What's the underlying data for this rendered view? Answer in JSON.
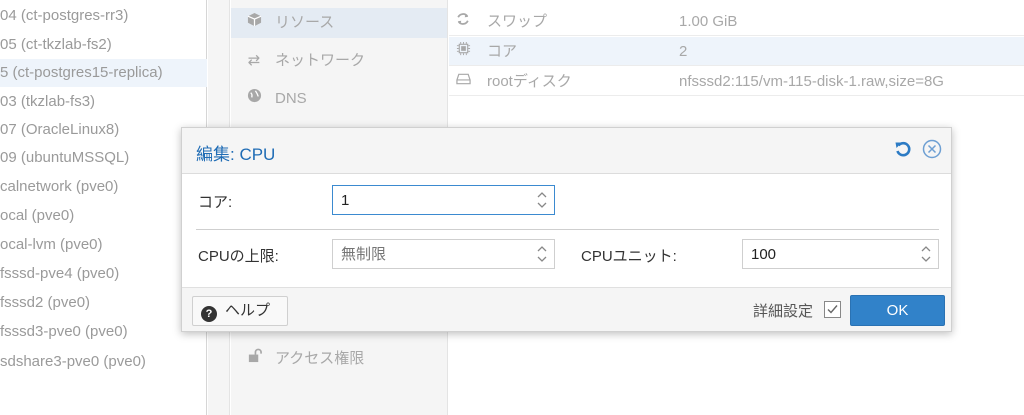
{
  "tree": {
    "items": [
      {
        "label": "04 (ct-postgres-rr3)",
        "selected": false
      },
      {
        "label": "05 (ct-tkzlab-fs2)",
        "selected": false
      },
      {
        "label": "5 (ct-postgres15-replica)",
        "selected": true
      },
      {
        "label": "03 (tkzlab-fs3)",
        "selected": false
      },
      {
        "label": "07 (OracleLinux8)",
        "selected": false
      },
      {
        "label": "09 (ubuntuMSSQL)",
        "selected": false
      },
      {
        "label": "calnetwork (pve0)",
        "selected": false
      },
      {
        "label": "ocal (pve0)",
        "selected": false
      },
      {
        "label": "ocal-lvm (pve0)",
        "selected": false
      },
      {
        "label": "fsssd-pve4 (pve0)",
        "selected": false
      },
      {
        "label": "fsssd2 (pve0)",
        "selected": false
      },
      {
        "label": "fsssd3-pve0 (pve0)",
        "selected": false
      },
      {
        "label": "sdshare3-pve0 (pve0)",
        "selected": false
      }
    ]
  },
  "nav": {
    "items": [
      {
        "label": "リソース",
        "icon": "cube-icon",
        "active": true
      },
      {
        "label": "ネットワーク",
        "icon": "exchange-icon",
        "active": false
      },
      {
        "label": "DNS",
        "icon": "globe-icon",
        "active": false
      }
    ],
    "access": {
      "label": "アクセス権限",
      "icon": "unlock-icon"
    }
  },
  "props": {
    "rows": [
      {
        "key": "スワップ",
        "value": "1.00 GiB",
        "icon": "refresh-icon",
        "highlight": false
      },
      {
        "key": "コア",
        "value": "2",
        "icon": "chip-icon",
        "highlight": true
      },
      {
        "key": "rootディスク",
        "value": "nfsssd2:115/vm-115-disk-1.raw,size=8G",
        "icon": "hdd-icon",
        "highlight": false
      }
    ]
  },
  "dialog": {
    "title": "編集: CPU",
    "cores_label": "コア:",
    "cores_value": "1",
    "cpulimit_label": "CPUの上限:",
    "cpulimit_placeholder": "無制限",
    "cpuunits_label": "CPUユニット:",
    "cpuunits_value": "100",
    "help_label": "ヘルプ",
    "advanced_label": "詳細設定",
    "advanced_checked": true,
    "ok_label": "OK"
  },
  "colors": {
    "accent": "#3182c9",
    "title": "#1f6cb5",
    "selected_row": "#eef4fb"
  }
}
